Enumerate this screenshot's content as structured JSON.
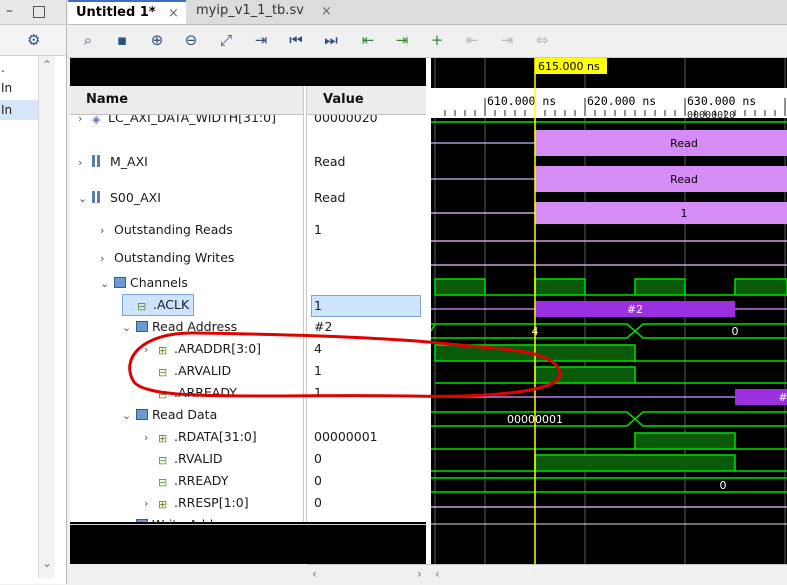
{
  "left_panel": {
    "rows": [
      ".",
      "In",
      "In"
    ]
  },
  "tabs": [
    {
      "label": "Untitled 1*",
      "active": true
    },
    {
      "label": "myip_v1_1_tb.sv",
      "active": false
    }
  ],
  "toolbar_icons": [
    "search-icon",
    "save-icon",
    "zoom-in-icon",
    "zoom-out-icon",
    "zoom-fit-icon",
    "go-to-cursor-icon",
    "go-to-start-icon",
    "go-to-end-icon",
    "previous-transition-icon",
    "next-transition-icon",
    "add-marker-icon",
    "previous-marker-icon",
    "next-marker-icon",
    "swap-cursors-icon"
  ],
  "headers": {
    "name": "Name",
    "value": "Value"
  },
  "signals": [
    {
      "name": "LC_AXI_DATA_WIDTH[31:0]",
      "value": "00000020",
      "indent": 0,
      "icon": "param",
      "chev": "›"
    },
    {
      "name": "M_AXI",
      "value": "Read",
      "indent": 0,
      "icon": "bus",
      "chev": "›"
    },
    {
      "name": "S00_AXI",
      "value": "Read",
      "indent": 0,
      "icon": "bus",
      "chev": "⌄"
    },
    {
      "name": "Outstanding Reads",
      "value": "1",
      "indent": 1,
      "icon": "",
      "chev": "›"
    },
    {
      "name": "Outstanding Writes",
      "value": "",
      "indent": 1,
      "icon": "",
      "chev": "›"
    },
    {
      "name": "Channels",
      "value": "",
      "indent": 1,
      "icon": "grp",
      "chev": "⌄"
    },
    {
      "name": ".ACLK",
      "value": "1",
      "indent": 2,
      "icon": "sig",
      "chev": ""
    },
    {
      "name": "Read Address",
      "value": "#2",
      "indent": 2,
      "icon": "grp",
      "chev": "⌄"
    },
    {
      "name": ".ARADDR[3:0]",
      "value": "4",
      "indent": 3,
      "icon": "vec",
      "chev": "›"
    },
    {
      "name": ".ARVALID",
      "value": "1",
      "indent": 3,
      "icon": "sig",
      "chev": ""
    },
    {
      "name": ".ARREADY",
      "value": "1",
      "indent": 3,
      "icon": "sig",
      "chev": ""
    },
    {
      "name": "Read Data",
      "value": "",
      "indent": 2,
      "icon": "grp",
      "chev": "⌄"
    },
    {
      "name": ".RDATA[31:0]",
      "value": "00000001",
      "indent": 3,
      "icon": "vec",
      "chev": "›"
    },
    {
      "name": ".RVALID",
      "value": "0",
      "indent": 3,
      "icon": "sig",
      "chev": ""
    },
    {
      "name": ".RREADY",
      "value": "0",
      "indent": 3,
      "icon": "sig",
      "chev": ""
    },
    {
      "name": ".RRESP[1:0]",
      "value": "0",
      "indent": 3,
      "icon": "vec",
      "chev": "›"
    },
    {
      "name": "Write Address",
      "value": "",
      "indent": 2,
      "icon": "grp",
      "chev": "›"
    }
  ],
  "timeline": {
    "cursor_label": "615.000 ns",
    "tick_labels": [
      "610.000 ns",
      "620.000 ns",
      "630.000 ns"
    ]
  },
  "waves": {
    "m_axi_label": "Read",
    "s00_axi_label": "Read",
    "outstanding_reads_label": "1",
    "read_address_label": "#2",
    "read_address_next_label": "#",
    "araddr_labels": [
      "4",
      "0"
    ],
    "rdata_label": "00000001",
    "rresp_label": "0",
    "param_overlay_label": "00000020"
  },
  "colors": {
    "wave_green": "#00e000",
    "bus_pink": "#d68cf5",
    "bus_purple": "#9b30e0",
    "cursor_yellow": "#ffff00",
    "annotation_red": "#e00000"
  }
}
